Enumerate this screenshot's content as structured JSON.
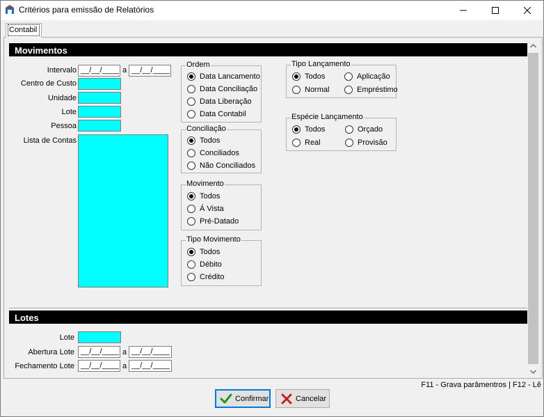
{
  "window": {
    "title": "Critérios para emissão de Relatórios"
  },
  "tab": {
    "label": "Contabil"
  },
  "movimentos": {
    "header": "Movimentos",
    "intervalo_label": "Intervalo",
    "intervalo_from": "__/__/____",
    "intervalo_sep": "a",
    "intervalo_to": "__/__/____",
    "centro_custo_label": "Centro de Custo",
    "unidade_label": "Unidade",
    "lote_label": "Lote",
    "pessoa_label": "Pessoa",
    "lista_contas_label": "Lista de Contas"
  },
  "ordem": {
    "legend": "Ordem",
    "options": [
      "Data Lancamento",
      "Data Conciliação",
      "Data Liberação",
      "Data Contabil"
    ],
    "selected": 0
  },
  "conciliacao": {
    "legend": "Conciliação",
    "options": [
      "Todos",
      "Conciliados",
      "Não Conciliados"
    ],
    "selected": 0
  },
  "movimento": {
    "legend": "Movimento",
    "options": [
      "Todos",
      "Á Vista",
      "Pré-Datado"
    ],
    "selected": 0
  },
  "tipo_movimento": {
    "legend": "Tipo Movimento",
    "options": [
      "Todos",
      "Débito",
      "Crédito"
    ],
    "selected": 0
  },
  "tipo_lancamento": {
    "legend": "Tipo Lançamento",
    "options": [
      "Todos",
      "Aplicação",
      "Normal",
      "Empréstimo"
    ],
    "selected": 0
  },
  "especie_lancamento": {
    "legend": "Espécie Lançamento",
    "options": [
      "Todos",
      "Orçado",
      "Real",
      "Provisão"
    ],
    "selected": 0
  },
  "lotes": {
    "header": "Lotes",
    "lote_label": "Lote",
    "abertura_label": "Abertura Lote",
    "abertura_from": "__/__/____",
    "abertura_sep": "a",
    "abertura_to": "__/__/____",
    "fechamento_label": "Fechamento Lote",
    "fechamento_from": "__/__/____",
    "fechamento_sep": "a",
    "fechamento_to": "__/__/____"
  },
  "status_text": "F11 - Grava parâmentros | F12 - Lê",
  "buttons": {
    "confirm_label": "Confirmar",
    "cancel_label": "Cancelar"
  },
  "colors": {
    "field": "#00ffff",
    "header": "#000000"
  }
}
